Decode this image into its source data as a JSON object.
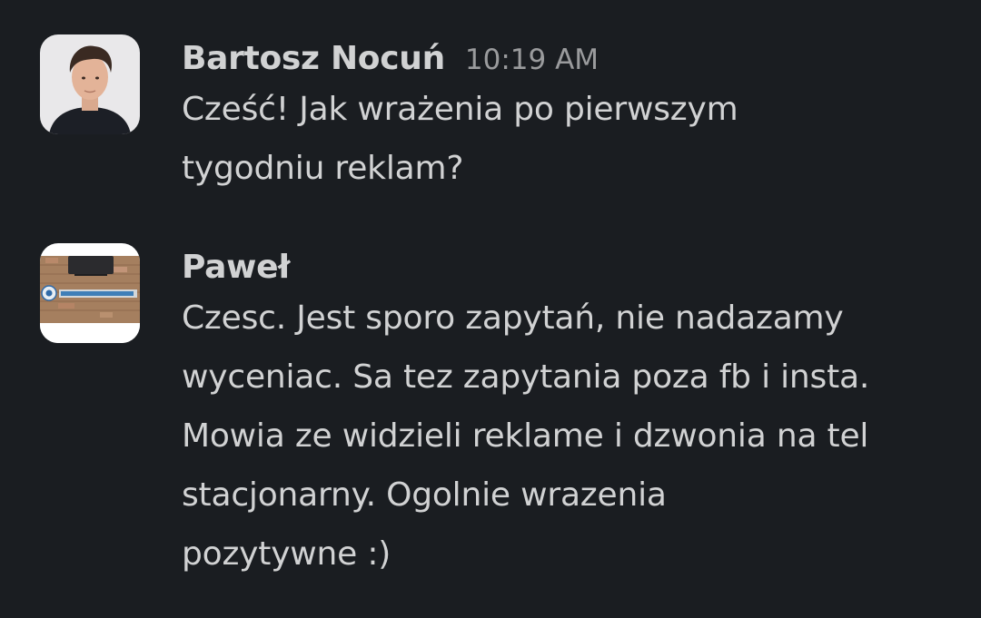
{
  "messages": [
    {
      "sender": "Bartosz Nocuń",
      "time": "10:19 AM",
      "avatar": "person-portrait",
      "lines": [
        "Cześć! Jak wrażenia po pierwszym",
        "tygodniu reklam?"
      ]
    },
    {
      "sender": "Paweł",
      "time": "",
      "avatar": "brick-wall-logo",
      "lines": [
        "Czesc. Jest sporo zapytań, nie nadazamy",
        "wyceniac. Sa tez zapytania poza fb i insta.",
        "Mowia ze widzieli reklame i dzwonia na tel",
        "stacjonarny. Ogolnie wrazenia",
        "pozytywne :)"
      ]
    }
  ],
  "colors": {
    "background": "#1a1d21",
    "text": "#d1d2d3",
    "timestamp": "#9a9b9d"
  }
}
